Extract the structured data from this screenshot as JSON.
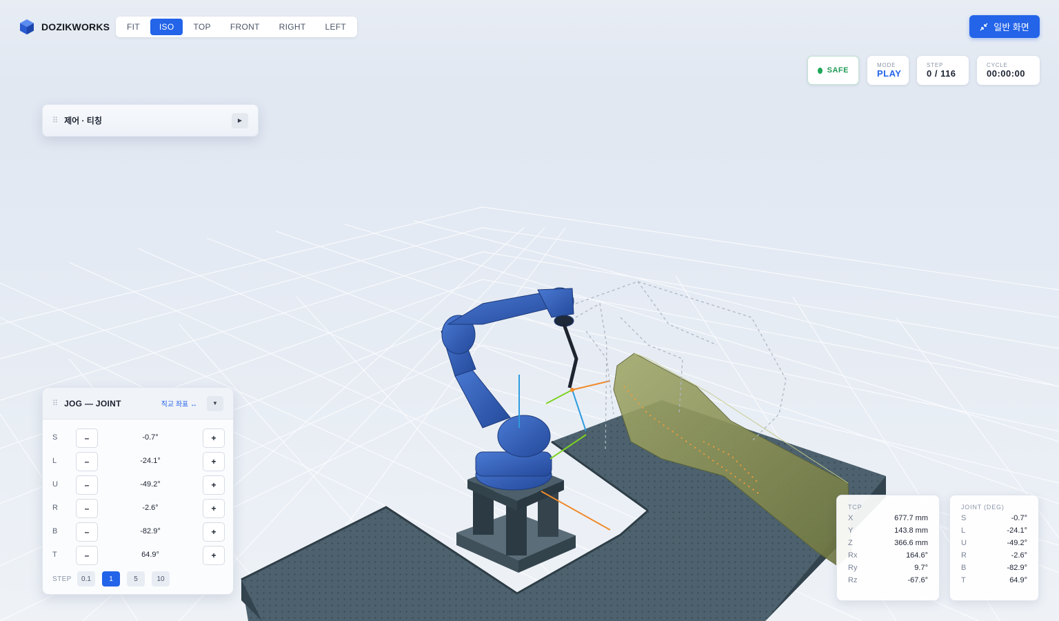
{
  "app": {
    "name": "DOZIKWORKS"
  },
  "view_bar": {
    "items": [
      "FIT",
      "ISO",
      "TOP",
      "FRONT",
      "RIGHT",
      "LEFT"
    ],
    "active": "ISO"
  },
  "normal_screen_label": "일반 화면",
  "status": {
    "safe": "SAFE",
    "mode": {
      "label": "MODE",
      "value": "PLAY"
    },
    "step": {
      "label": "STEP",
      "value": "0 / 116"
    },
    "cycle": {
      "label": "CYCLE",
      "value": "00:00:00"
    }
  },
  "control_panel": {
    "title": "제어 · 티칭"
  },
  "jog": {
    "title": "JOG — JOINT",
    "switch_label": "직교 좌표 ↔",
    "minus": "–",
    "plus": "+",
    "rows": [
      {
        "axis": "S",
        "value": "-0.7°"
      },
      {
        "axis": "L",
        "value": "-24.1°"
      },
      {
        "axis": "U",
        "value": "-49.2°"
      },
      {
        "axis": "R",
        "value": "-2.6°"
      },
      {
        "axis": "B",
        "value": "-82.9°"
      },
      {
        "axis": "T",
        "value": "64.9°"
      }
    ],
    "step_label": "STEP",
    "step_options": [
      "0.1",
      "1",
      "5",
      "10"
    ],
    "step_active": "1"
  },
  "tcp": {
    "title": "TCP",
    "rows": [
      {
        "k": "X",
        "v": "677.7 mm"
      },
      {
        "k": "Y",
        "v": "143.8 mm"
      },
      {
        "k": "Z",
        "v": "366.6 mm"
      },
      {
        "k": "Rx",
        "v": "164.6°"
      },
      {
        "k": "Ry",
        "v": "9.7°"
      },
      {
        "k": "Rz",
        "v": "-67.6°"
      }
    ]
  },
  "joint": {
    "title": "JOINT (DEG)",
    "rows": [
      {
        "k": "S",
        "v": "-0.7°"
      },
      {
        "k": "L",
        "v": "-24.1°"
      },
      {
        "k": "U",
        "v": "-49.2°"
      },
      {
        "k": "R",
        "v": "-2.6°"
      },
      {
        "k": "B",
        "v": "-82.9°"
      },
      {
        "k": "T",
        "v": "64.9°"
      }
    ]
  },
  "colors": {
    "accent": "#2364e8",
    "safe": "#1fa85a",
    "table": "#4a5f6c",
    "robot": "#2f5fb8",
    "part": "#8a9153"
  },
  "icons": [
    "cube-logo-icon",
    "collapse-screen-icon",
    "drag-handle-icon",
    "play-icon",
    "chevron-down-icon"
  ]
}
